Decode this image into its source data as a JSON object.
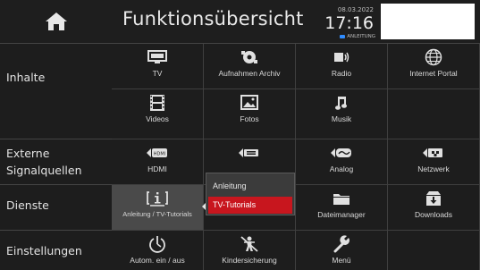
{
  "header": {
    "title": "Funktionsübersicht",
    "date": "08.03.2022",
    "time": "17:16",
    "status": "ANLEITUNG",
    "status_color": "#2f8cff"
  },
  "sections": [
    {
      "label_line1": "Inhalte",
      "label_line2": ""
    },
    {
      "label_line1": "Externe",
      "label_line2": "Signalquellen"
    },
    {
      "label_line1": "Dienste",
      "label_line2": ""
    },
    {
      "label_line1": "Einstellungen",
      "label_line2": ""
    }
  ],
  "tiles": {
    "tv": {
      "label": "TV",
      "icon": "tv-icon"
    },
    "aufnahmen": {
      "label": "Aufnahmen Archiv",
      "icon": "recordings-icon"
    },
    "radio": {
      "label": "Radio",
      "icon": "radio-icon"
    },
    "internet": {
      "label": "Internet Portal",
      "icon": "globe-icon"
    },
    "videos": {
      "label": "Videos",
      "icon": "film-icon"
    },
    "fotos": {
      "label": "Fotos",
      "icon": "photo-icon"
    },
    "musik": {
      "label": "Musik",
      "icon": "music-note-icon"
    },
    "hdmi": {
      "label": "HDMI",
      "icon": "hdmi-input-icon"
    },
    "input2": {
      "label": "",
      "icon": "input-arrow-icon"
    },
    "analog": {
      "label": "Analog",
      "icon": "analog-input-icon"
    },
    "netzwerk": {
      "label": "Netzwerk",
      "icon": "network-input-icon"
    },
    "anleitung": {
      "label": "Anleitung / TV-Tutorials",
      "icon": "info-screen-icon"
    },
    "dateimanager": {
      "label": "Dateimanager",
      "icon": "folder-icon"
    },
    "downloads": {
      "label": "Downloads",
      "icon": "download-box-icon"
    },
    "autom": {
      "label": "Autom. ein / aus",
      "icon": "power-timer-icon"
    },
    "kinder": {
      "label": "Kindersicherung",
      "icon": "child-lock-icon"
    },
    "menu": {
      "label": "Menü",
      "icon": "wrench-icon"
    }
  },
  "popup": {
    "options": [
      "Anleitung",
      "TV-Tutorials"
    ],
    "selected": "TV-Tutorials",
    "highlight_color": "#c8161e"
  }
}
